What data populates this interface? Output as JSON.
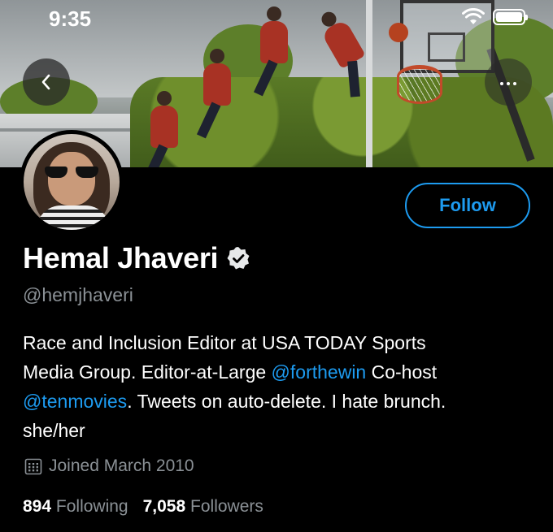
{
  "status_bar": {
    "time": "9:35"
  },
  "profile": {
    "display_name": "Hemal Jhaveri",
    "handle": "@hemjhaveri",
    "verified": true,
    "follow_label": "Follow",
    "bio_line1": "Race and Inclusion Editor at USA TODAY Sports",
    "bio_line2_prefix": "Media Group. Editor-at-Large ",
    "bio_mention1": "@forthewin",
    "bio_line2_suffix": " Co-host",
    "bio_mention2": "@tenmovies",
    "bio_line3_suffix": ". Tweets on auto-delete. I hate brunch.",
    "bio_line4": "she/her",
    "joined": "Joined March 2010",
    "following_count": "894",
    "following_label": "Following",
    "followers_count": "7,058",
    "followers_label": "Followers"
  },
  "icons": {
    "back": "chevron-left-icon",
    "more": "ellipsis-icon",
    "verified": "verified-badge-icon",
    "calendar": "calendar-icon"
  },
  "colors": {
    "accent": "#1d9bf0",
    "secondary_text": "#8b9196",
    "background": "#000000"
  }
}
